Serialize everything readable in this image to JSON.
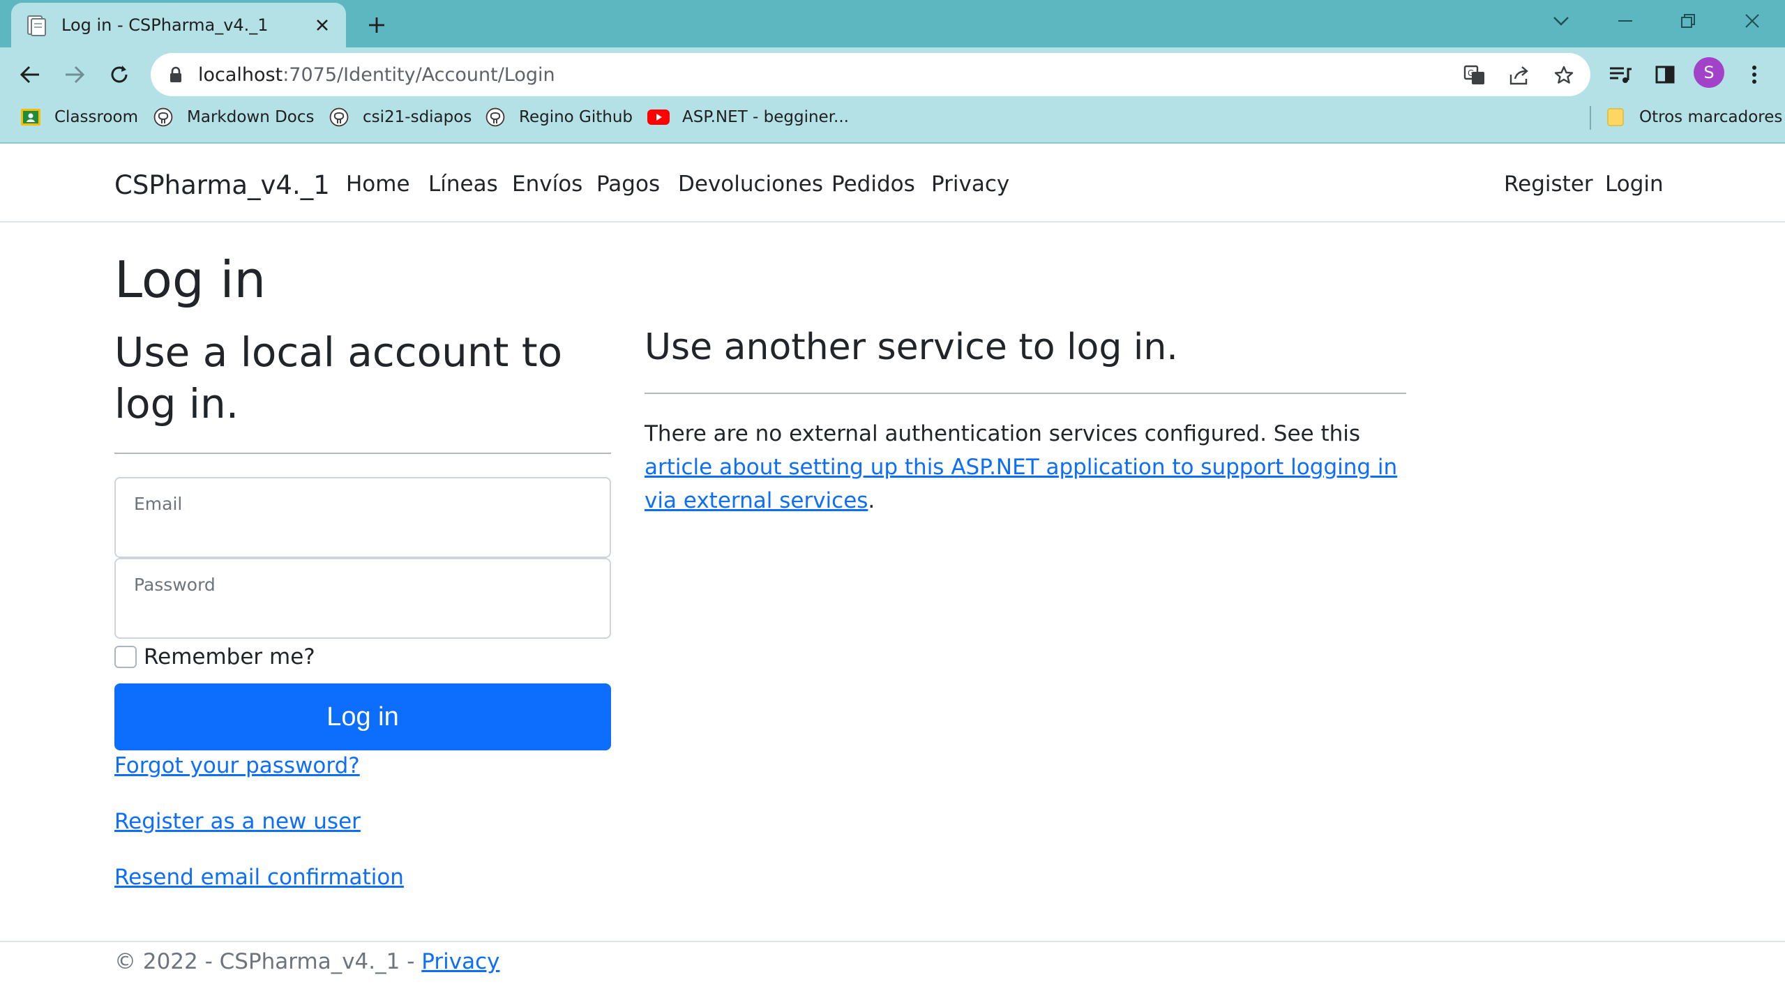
{
  "browser": {
    "tab_title": "Log in - CSPharma_v4._1",
    "url_host": "localhost",
    "url_path": ":7075/Identity/Account/Login",
    "avatar_letter": "S",
    "bookmarks": [
      {
        "label": "Classroom",
        "icon": "classroom-icon"
      },
      {
        "label": "Markdown Docs",
        "icon": "github-icon"
      },
      {
        "label": "csi21-sdiapos",
        "icon": "github-icon"
      },
      {
        "label": "Regino Github",
        "icon": "github-icon"
      },
      {
        "label": "ASP.NET - begginer...",
        "icon": "youtube-icon"
      }
    ],
    "other_bookmarks": "Otros marcadores",
    "colors": {
      "tabstrip": "#5cb7c1",
      "toolbar": "#b3e1e6",
      "avatar": "#a142c9"
    }
  },
  "nav": {
    "brand": "CSPharma_v4._1",
    "links": [
      "Home",
      "Líneas",
      "Envíos",
      "Pagos",
      "Devoluciones",
      "Pedidos",
      "Privacy"
    ],
    "register": "Register",
    "login": "Login"
  },
  "main": {
    "title": "Log in",
    "local_heading": "Use a local account to log in.",
    "email_label": "Email",
    "email_value": "",
    "password_label": "Password",
    "password_value": "",
    "remember_label": "Remember me?",
    "remember_checked": false,
    "login_button": "Log in",
    "forgot_link": "Forgot your password?",
    "register_link": "Register as a new user",
    "resend_link": "Resend email confirmation",
    "external_heading": "Use another service to log in.",
    "external_text_before": "There are no external authentication services configured. See this ",
    "external_link": "article about setting up this ASP.NET application to support logging in via external services",
    "external_text_after": ".",
    "colors": {
      "primary": "#0d6efd",
      "text": "#212529"
    }
  },
  "footer": {
    "copyright": "© 2022 - CSPharma_v4._1 - ",
    "privacy_link": "Privacy"
  }
}
